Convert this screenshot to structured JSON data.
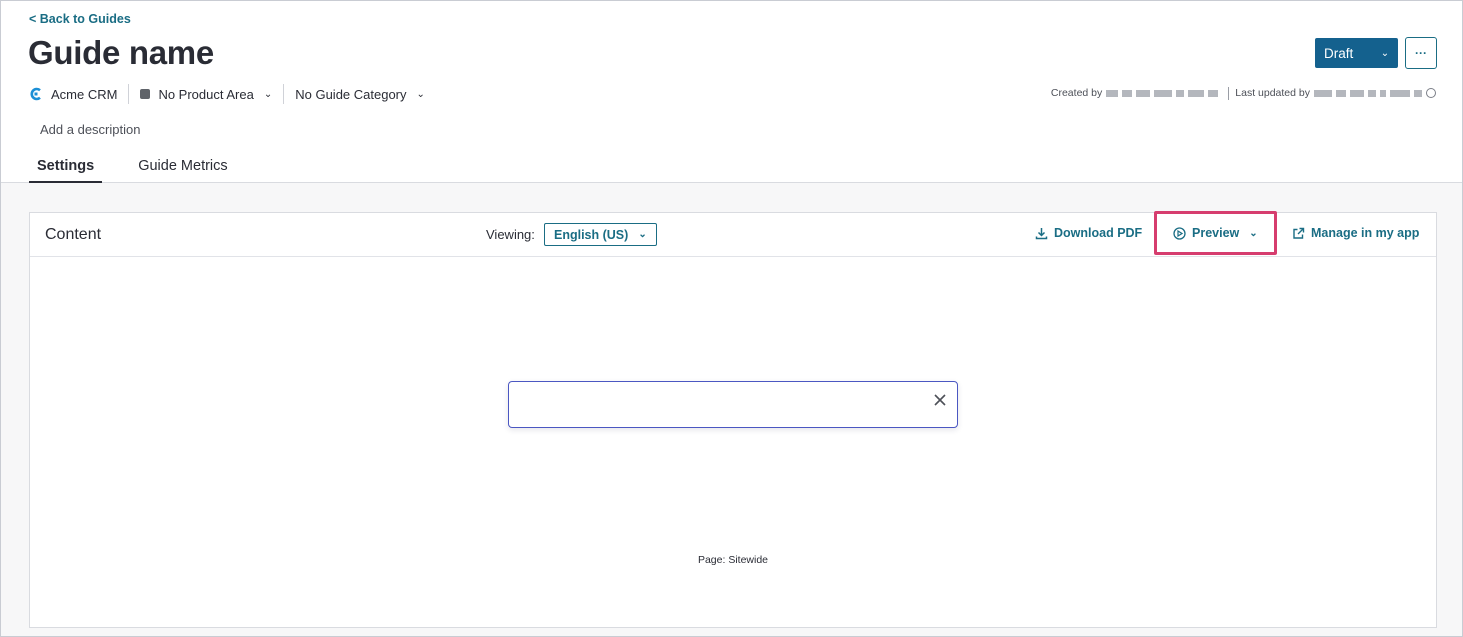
{
  "nav": {
    "back_label": "< Back to Guides"
  },
  "guide": {
    "title": "Guide name",
    "description_placeholder": "Add a description"
  },
  "meta": {
    "app_name": "Acme CRM",
    "product_area": "No Product Area",
    "guide_category": "No Guide Category",
    "created_by_label": "Created by",
    "last_updated_label": "Last updated by"
  },
  "status": {
    "label": "Draft"
  },
  "more_label": "···",
  "tabs": [
    {
      "label": "Settings",
      "active": true
    },
    {
      "label": "Guide Metrics",
      "active": false
    }
  ],
  "content_panel": {
    "title": "Content",
    "viewing_label": "Viewing:",
    "language": "English (US)",
    "download_label": "Download PDF",
    "preview_label": "Preview",
    "manage_label": "Manage in my app",
    "page_label": "Page: Sitewide"
  },
  "colors": {
    "accent": "#1a6d84",
    "primary_button": "#14618e",
    "highlight": "#d63d6e",
    "search_border": "#4b57c2"
  }
}
